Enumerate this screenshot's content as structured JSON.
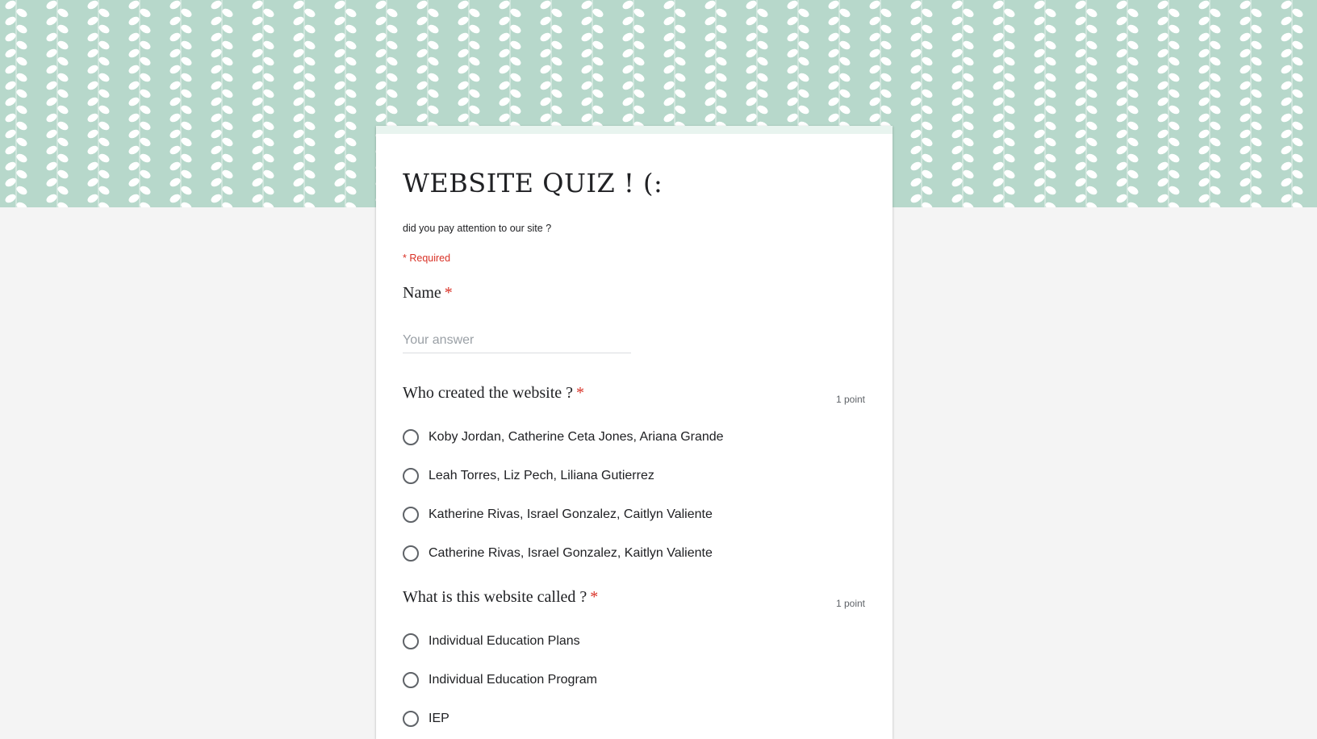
{
  "colors": {
    "banner_background": "#b7d8cb",
    "banner_pattern": "#ffffff",
    "page_background": "#f4f4f4",
    "required": "#d93025"
  },
  "form": {
    "title": "WEBSITE QUIZ ! (:",
    "description": "did you pay attention to our site ?",
    "required_note": "* Required"
  },
  "questions": [
    {
      "title": "Name",
      "required_mark": "*",
      "placeholder": "Your answer"
    },
    {
      "title": "Who created the website ?",
      "required_mark": "*",
      "points": "1 point",
      "options": [
        "Koby Jordan, Catherine Ceta Jones, Ariana Grande",
        "Leah Torres, Liz Pech, Liliana Gutierrez",
        "Katherine Rivas, Israel Gonzalez, Caitlyn Valiente",
        "Catherine Rivas, Israel Gonzalez, Kaitlyn Valiente"
      ]
    },
    {
      "title": "What is this website called ?",
      "required_mark": "*",
      "points": "1 point",
      "options": [
        "Individual Education Plans",
        "Individual Education Program",
        "IEP"
      ]
    }
  ]
}
